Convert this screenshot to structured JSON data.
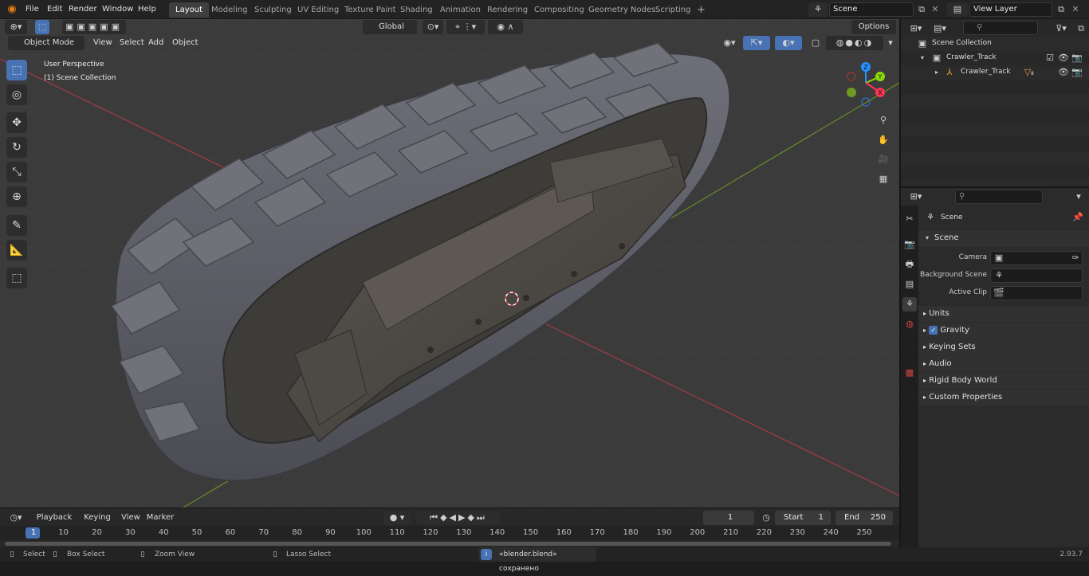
{
  "topbar": {
    "menus": [
      "File",
      "Edit",
      "Render",
      "Window",
      "Help"
    ],
    "workspaces": [
      "Layout",
      "Modeling",
      "Sculpting",
      "UV Editing",
      "Texture Paint",
      "Shading",
      "Animation",
      "Rendering",
      "Compositing",
      "Geometry Nodes",
      "Scripting"
    ],
    "add_tab": "+",
    "scene": "Scene",
    "view_layer": "View Layer"
  },
  "viewport": {
    "mode": "Object Mode",
    "menus": [
      "View",
      "Select",
      "Add",
      "Object"
    ],
    "transform_orientation": "Global",
    "options": "Options",
    "overlay_line1": "User Perspective",
    "overlay_line2": "(1) Scene Collection",
    "gizmo": {
      "z": "Z",
      "y": "Y",
      "x": "X"
    }
  },
  "outliner": {
    "search_placeholder": "",
    "rows": [
      "Scene Collection",
      "Crawler_Track",
      "Crawler_Track"
    ],
    "modifier_count": "8"
  },
  "properties": {
    "context": "Scene",
    "section": "Scene",
    "fields": [
      {
        "label": "Camera",
        "value": ""
      },
      {
        "label": "Background Scene",
        "value": ""
      },
      {
        "label": "Active Clip",
        "value": ""
      }
    ],
    "panels": [
      "Units",
      "Gravity",
      "Keying Sets",
      "Audio",
      "Rigid Body World",
      "Custom Properties"
    ]
  },
  "timeline": {
    "menus": [
      "Playback",
      "Keying",
      "View",
      "Marker"
    ],
    "current_frame": "1",
    "start_label": "Start",
    "start": "1",
    "end_label": "End",
    "end": "250",
    "ruler": [
      "1",
      "10",
      "20",
      "30",
      "40",
      "50",
      "60",
      "70",
      "80",
      "90",
      "100",
      "110",
      "120",
      "130",
      "140",
      "150",
      "160",
      "170",
      "180",
      "190",
      "200",
      "210",
      "220",
      "230",
      "240",
      "250"
    ]
  },
  "status": {
    "select": "Select",
    "box_select": "Box Select",
    "zoom_view": "Zoom View",
    "lasso_select": "Lasso Select",
    "message": "«blender.blend» сохранено",
    "version": "2.93.7"
  },
  "colors": {
    "accent": "#4772b3",
    "x_axis": "#ff3352",
    "y_axis": "#8bdc00",
    "z_axis": "#2890ff"
  }
}
